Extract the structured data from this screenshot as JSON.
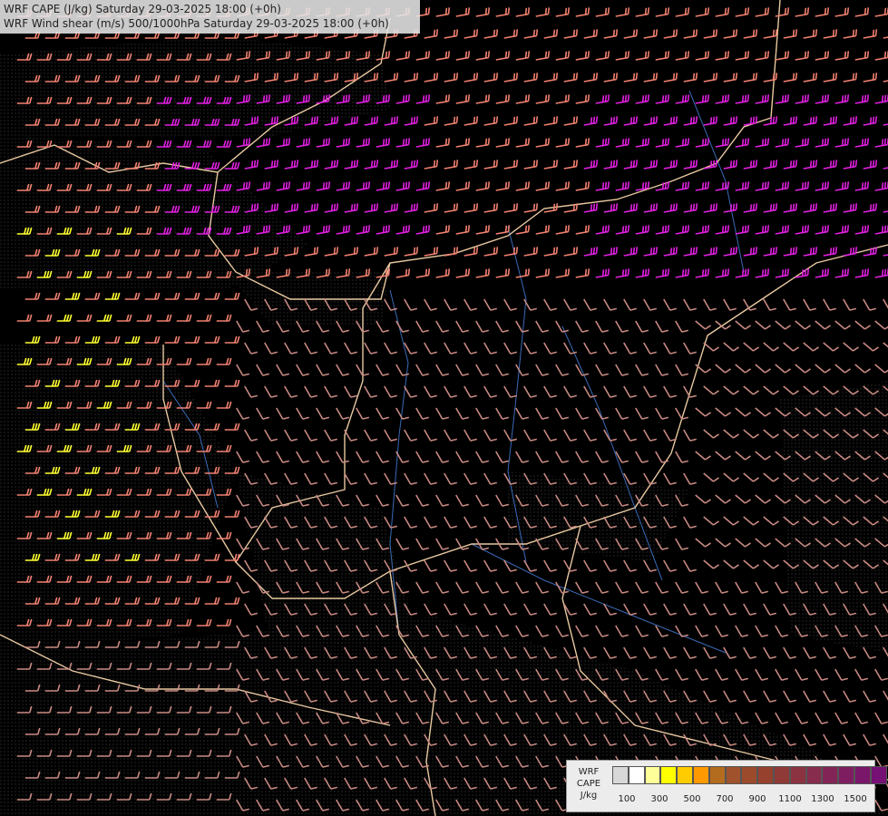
{
  "title": {
    "line1": "WRF CAPE (J/kg) Saturday 29-03-2025 18:00 (+0h)",
    "line2": "WRF Wind shear (m/s) 500/1000hPa Saturday 29-03-2025 18:00 (+0h)"
  },
  "legend": {
    "label_lines": [
      "WRF",
      "CAPE",
      "J/kg"
    ],
    "colors": [
      "#d8d8d8",
      "#ffffff",
      "#ffff99",
      "#ffff00",
      "#ffcc00",
      "#ff9900",
      "#b36b1e",
      "#a0522d",
      "#9c4a2c",
      "#96402e",
      "#903a38",
      "#8c3342",
      "#872c4c",
      "#822556",
      "#7e1e60",
      "#7a176a",
      "#761074"
    ],
    "tick_labels": [
      "100",
      "300",
      "500",
      "700",
      "900",
      "1100",
      "1300",
      "1500"
    ]
  },
  "colors": {
    "barb_low": "#c88a82",
    "barb_mid": "#f08070",
    "barb_high": "#e020e0",
    "barb_very_high": "#ffff30",
    "border": "#e8c8a0",
    "river": "#3a6ab8",
    "terrain": "#8a8a8a",
    "background": "#000000"
  }
}
